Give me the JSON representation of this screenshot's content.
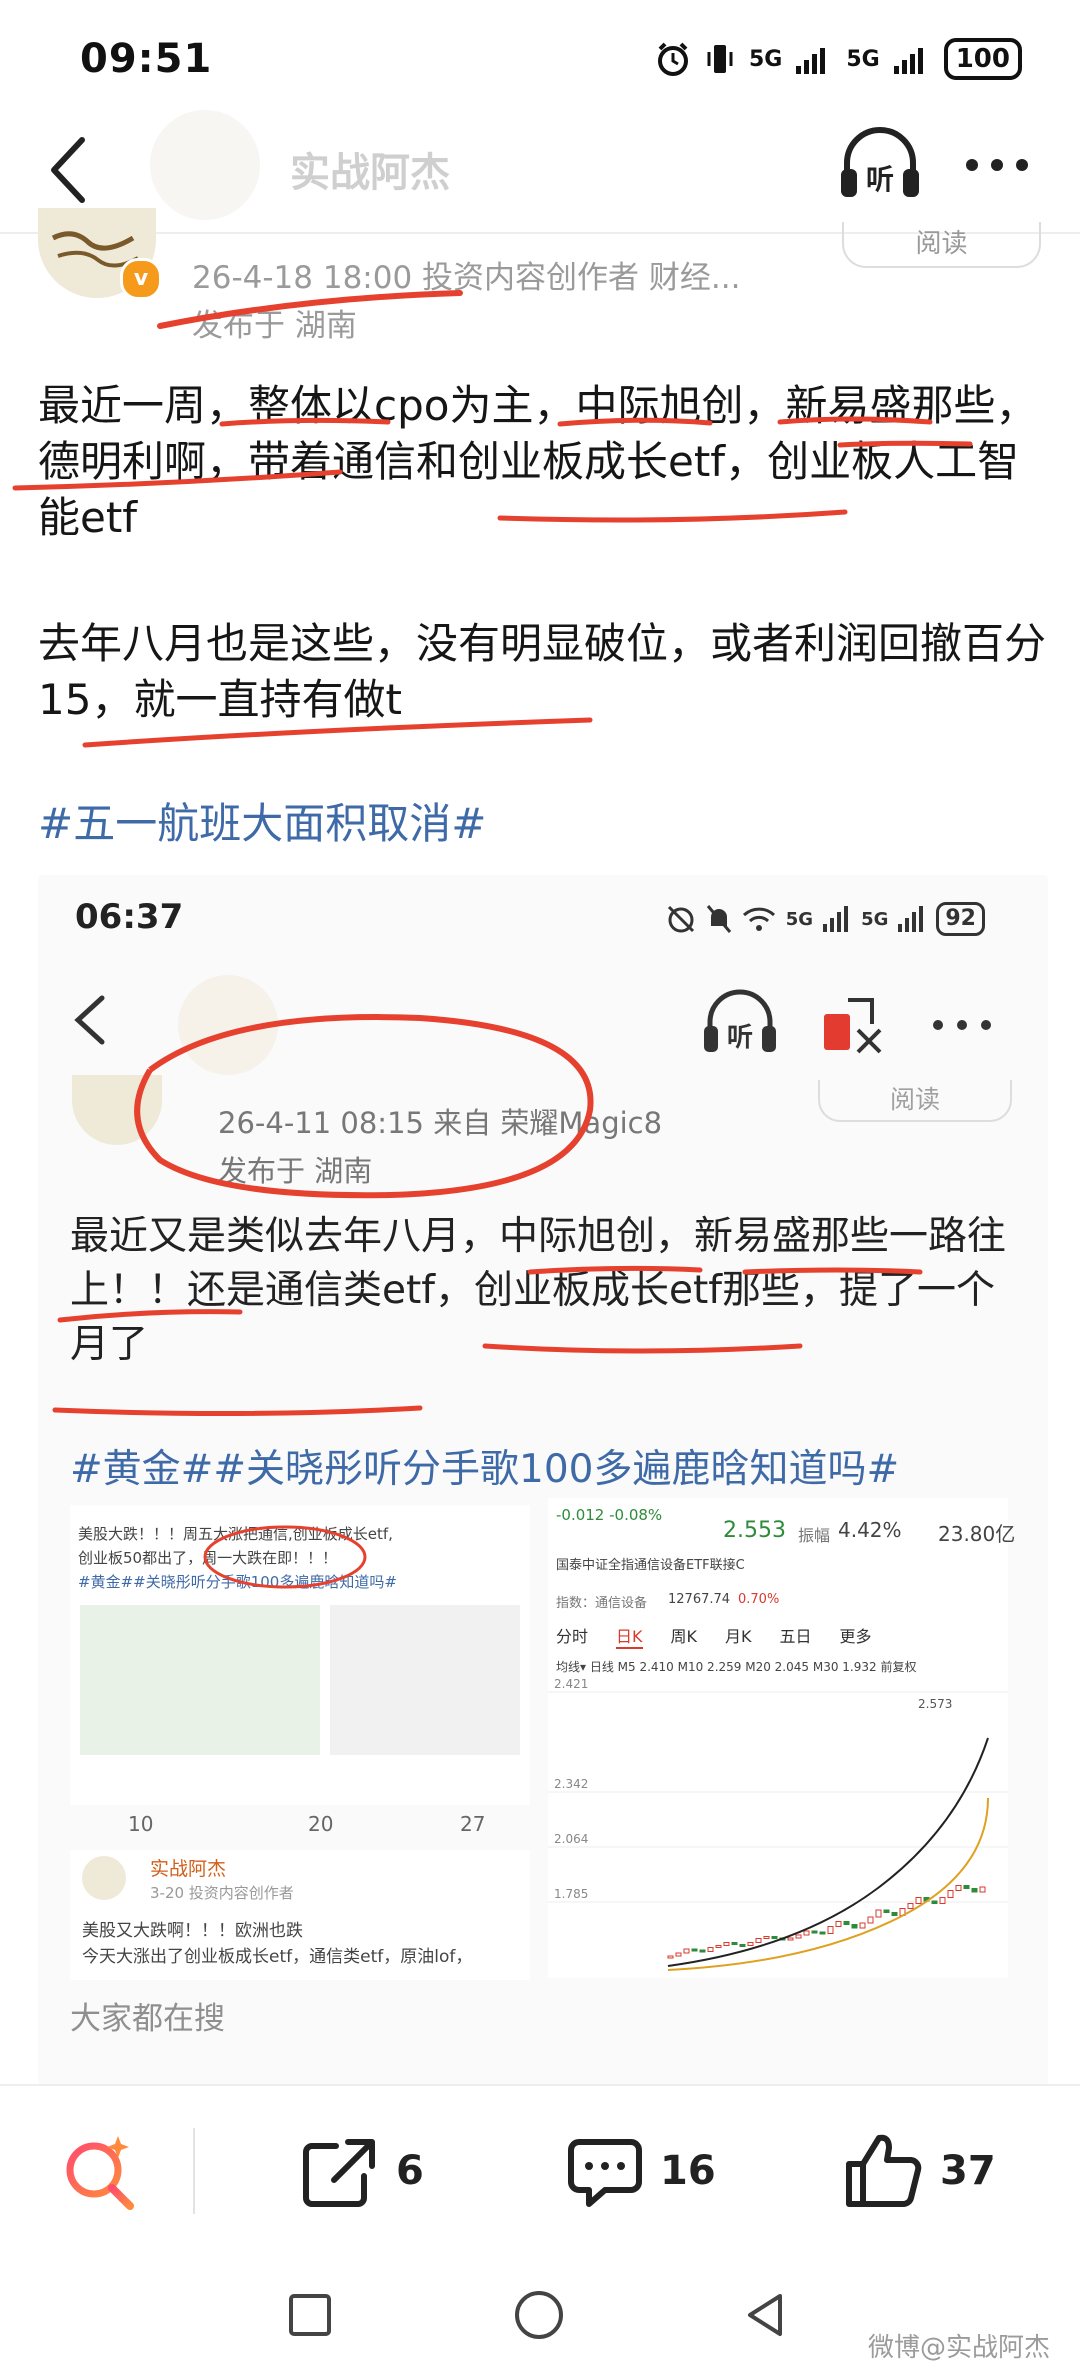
{
  "status_bar": {
    "time": "09:51",
    "network1": "5G",
    "network2": "5G",
    "battery": "100"
  },
  "header": {
    "author": "实战阿杰",
    "listen_label": "听"
  },
  "post": {
    "read_label": "阅读",
    "meta": "26-4-18 18:00  投资内容创作者 财经...",
    "location": "发布于 湖南",
    "paragraph1": "最近一周，整体以cpo为主，中际旭创，新易盛那些，德明利啊，带着通信和创业板成长etf，创业板人工智能etf",
    "paragraph2": "去年八月也是这些，没有明显破位，或者利润回撤百分15，就一直持有做t",
    "hashtag": "#五一航班大面积取消#"
  },
  "embedded": {
    "time": "06:37",
    "network1": "5G",
    "network2": "5G",
    "battery": "92",
    "listen_label": "听",
    "read_label": "阅读",
    "meta": "26-4-11 08:15  来自 荣耀Magic8",
    "location": "发布于 湖南",
    "paragraph": "最近又是类似去年八月，中际旭创，新易盛那些一路往上！！还是通信类etf，创业板成长etf那些，提了一个月了",
    "hashtag": "#黄金##关晓彤听分手歌100多遍鹿晗知道吗#",
    "thumb_left": {
      "line1": "美股大跌！！！周五大涨把通信,创业板成长etf,",
      "line2": "创业板50都出了，周一大跌在即！！！",
      "line3": "#黄金##关晓彤听分手歌100多遍鹿晗知道吗#",
      "share_count": "10",
      "comment_count": "20",
      "like_count": "27",
      "author": "实战阿杰",
      "date": "3-20  投资内容创作者",
      "text1": "美股又大跌啊！！！欧洲也跌",
      "text2": "今天大涨出了创业板成长etf，通信类etf，原油lof，"
    },
    "thumb_right": {
      "change": "-0.012  -0.08%",
      "price": "2.553",
      "amp_label": "振幅",
      "amp": "4.42%",
      "amount": "23.80亿",
      "fund": "国泰中证全指通信设备ETF联接C",
      "index_label": "指数：通信设备",
      "index_value": "12767.74",
      "index_change": "0.70%",
      "tabs": [
        "分时",
        "日K",
        "周K",
        "月K",
        "五日",
        "更多"
      ],
      "ma_line": "均线▾  日线  M5 2.410  M10 2.259  M20 2.045  M30 1.932  前复权",
      "axis": [
        "2.421",
        "2.342",
        "2.064",
        "1.785"
      ],
      "peak": "2.573"
    },
    "search_label": "大家都在搜"
  },
  "actions": {
    "share_count": "6",
    "comment_count": "16",
    "like_count": "37"
  },
  "watermark": "微博@实战阿杰",
  "colors": {
    "accent_hashtag": "#3f6aa8",
    "annotation_red": "#e6412f",
    "badge_orange": "#f59a1b"
  }
}
